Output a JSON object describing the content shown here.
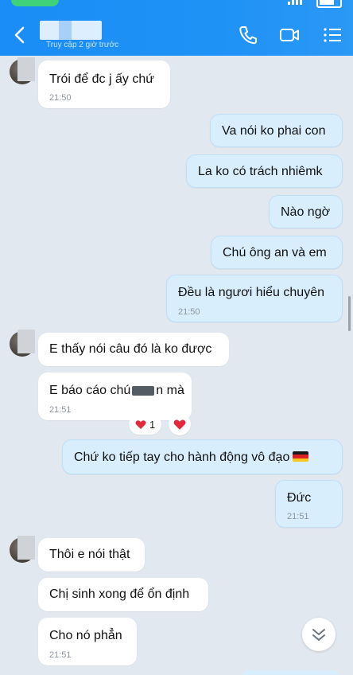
{
  "header": {
    "last_seen": "Truy cập 2 giờ trước",
    "color": "#1a8df6",
    "icons": [
      "back-icon",
      "phone-icon",
      "video-call-icon",
      "menu-list-icon"
    ]
  },
  "messages": [
    {
      "text": "Trói để đc j ấy chứ",
      "time": "21:50"
    },
    {
      "text": "Va nói ko phai con"
    },
    {
      "text": "La ko có trách nhiêmk"
    },
    {
      "text": "Nào ngờ"
    },
    {
      "text": "Chú ông an và em"
    },
    {
      "text": "Đều là ngươi hiểu chuyên",
      "time": "21:50"
    },
    {
      "text": "E thấy nói câu đó là ko được"
    },
    {
      "text_before": "E báo cáo chú",
      "text_after": "n mà",
      "time": "21:51",
      "reaction_count": "1"
    },
    {
      "text": "Chứ ko tiếp tay cho hành động vô đạo"
    },
    {
      "text": "Đức",
      "time": "21:51"
    },
    {
      "text": "Thôi e nói thật"
    },
    {
      "text": "Chị sinh xong để ổn định"
    },
    {
      "text": "Cho nó phẳn",
      "time": "21:51"
    }
  ],
  "colors": {
    "incoming_bubble": "#ffffff",
    "outgoing_bubble": "#d8eefd",
    "background": "#e2e8ef",
    "reaction_heart": "#e5283c"
  }
}
